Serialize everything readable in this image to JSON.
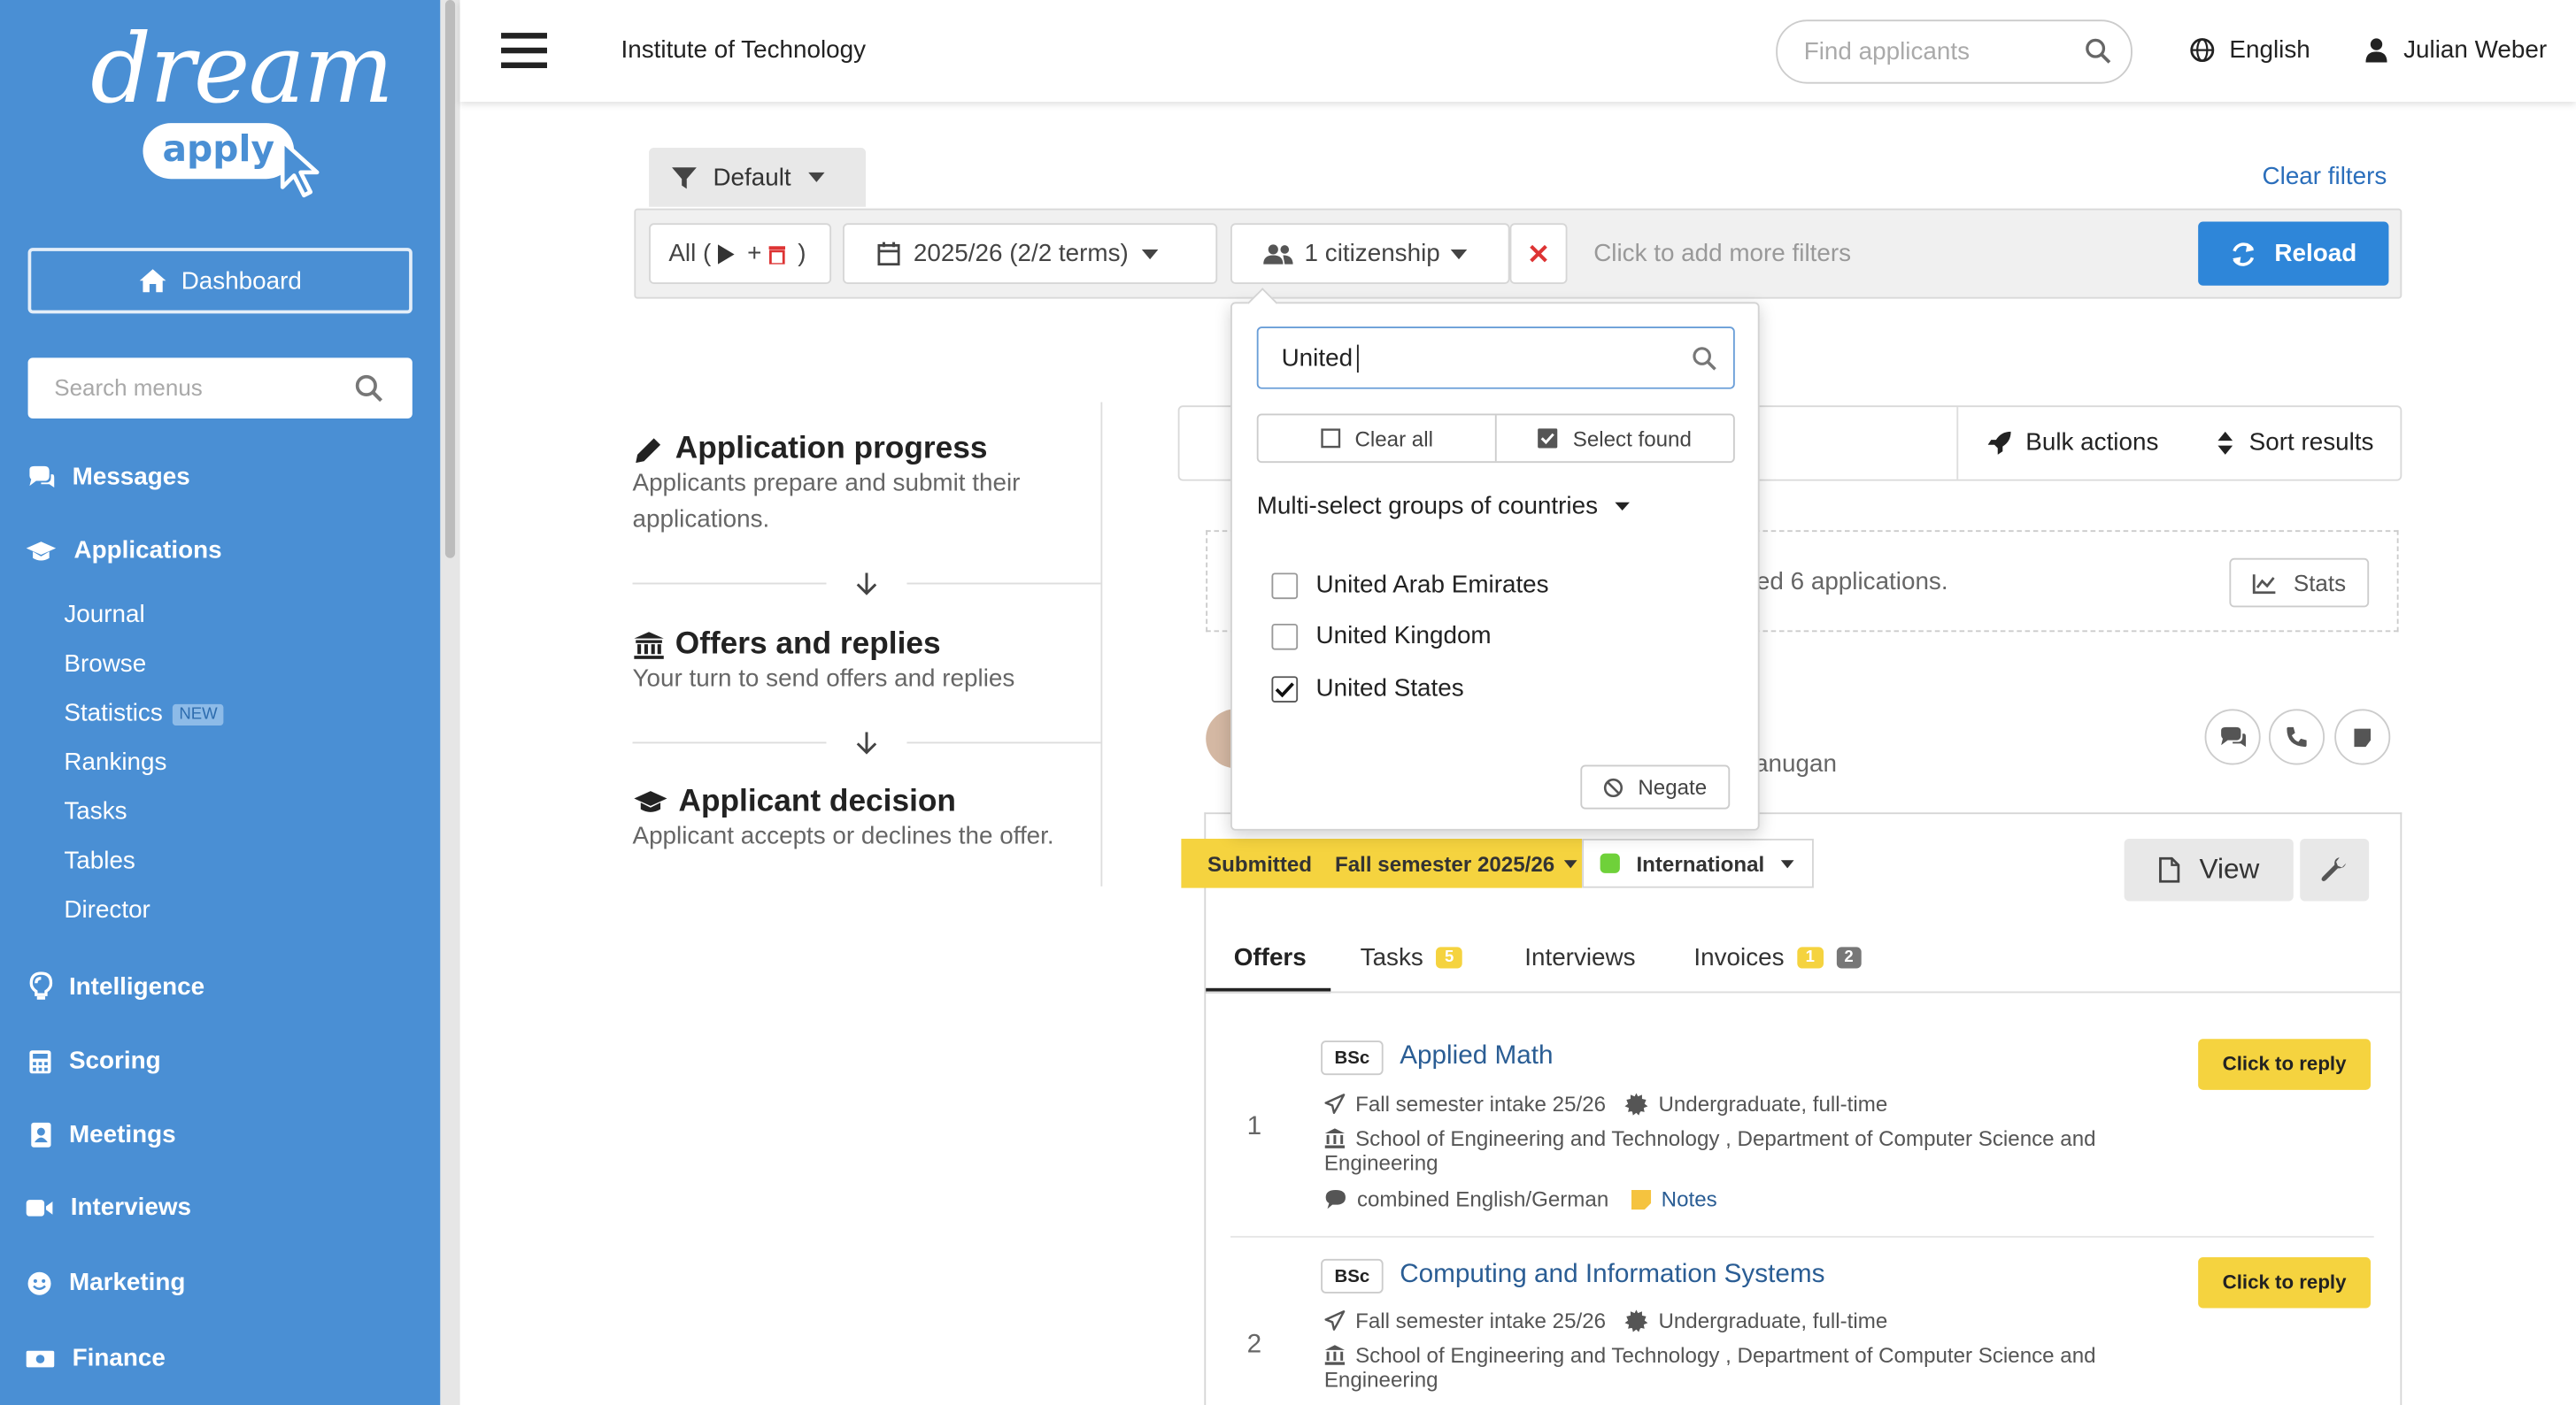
{
  "sidebar": {
    "logo_main": "dream",
    "logo_sub": "apply",
    "dashboard": "Dashboard",
    "search_placeholder": "Search menus",
    "messages": "Messages",
    "applications": "Applications",
    "journal": "Journal",
    "browse": "Browse",
    "statistics": "Statistics",
    "statistics_badge": "NEW",
    "rankings": "Rankings",
    "tasks": "Tasks",
    "tables": "Tables",
    "director": "Director",
    "intelligence": "Intelligence",
    "scoring": "Scoring",
    "meetings": "Meetings",
    "interviews": "Interviews",
    "marketing": "Marketing",
    "finance": "Finance"
  },
  "topbar": {
    "institution": "Institute of Technology",
    "search_placeholder": "Find applicants",
    "language": "English",
    "user": "Julian Weber"
  },
  "filters": {
    "preset": "Default",
    "clear_filters": "Clear filters",
    "all_prefix": "All (",
    "all_plus": "+",
    "all_suffix": ")",
    "term": "2025/26 (2/2 terms)",
    "citizenship": "1 citizenship",
    "add_more": "Click to add more filters",
    "reload": "Reload"
  },
  "process": {
    "progress_title": "Application progress",
    "progress_text": "Applicants prepare and submit their applications.",
    "offers_title": "Offers and replies",
    "offers_text": "Your turn to send offers and replies",
    "decision_title": "Applicant decision",
    "decision_text": "Applicant accepts or declines the offer."
  },
  "toolbar": {
    "bulk_actions": "Bulk actions",
    "sort_results": "Sort results"
  },
  "results": {
    "found_text": "ed 6 applications.",
    "stats": "Stats"
  },
  "applicant": {
    "partial_name": "anugan"
  },
  "dropdown": {
    "search_value": "United",
    "clear_all": "Clear all",
    "select_found": "Select found",
    "groups": "Multi-select groups of countries",
    "countries": [
      {
        "name": "United Arab Emirates",
        "checked": false
      },
      {
        "name": "United Kingdom",
        "checked": false
      },
      {
        "name": "United States",
        "checked": true
      }
    ],
    "negate": "Negate"
  },
  "application": {
    "status": "Submitted",
    "semester": "Fall semester 2025/26",
    "type": "International",
    "type_color": "#6fd13a",
    "view": "View",
    "tabs": {
      "offers": "Offers",
      "tasks": "Tasks",
      "tasks_count": "5",
      "interviews": "Interviews",
      "invoices": "Invoices",
      "invoices_count_a": "1",
      "invoices_count_b": "2"
    },
    "offers": [
      {
        "index": "1",
        "degree": "BSc",
        "program": "Applied Math",
        "intake": "Fall semester intake 25/26",
        "level": "Undergraduate, full-time",
        "school_line1": "School of Engineering and Technology , Department of Computer Science and",
        "school_line2": "Engineering",
        "language": "combined English/German",
        "notes": "Notes",
        "reply": "Click to reply"
      },
      {
        "index": "2",
        "degree": "BSc",
        "program": "Computing and Information Systems",
        "intake": "Fall semester intake 25/26",
        "level": "Undergraduate, full-time",
        "school_line1": "School of Engineering and Technology , Department of Computer Science and",
        "school_line2": "Engineering",
        "reply": "Click to reply"
      }
    ]
  }
}
